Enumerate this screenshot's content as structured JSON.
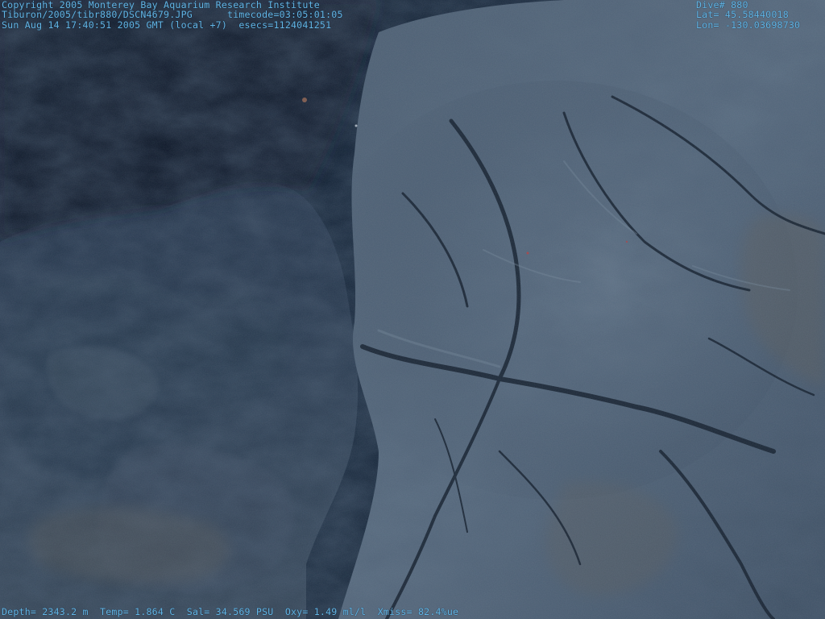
{
  "overlay": {
    "top_left": {
      "line1": "Copyright 2005 Monterey Bay Aquarium Research Institute",
      "line2": "Tiburon/2005/tibr880/DSCN4679.JPG      timecode=03:05:01:05",
      "line3": "Sun Aug 14 17:40:51 2005 GMT (local +7)  esecs=1124041251"
    },
    "top_right": {
      "dive": "Dive# 880",
      "lat": "Lat= 45.58440018",
      "lon": "Lon= -130.03698730"
    },
    "bottom": "Depth= 2343.2 m  Temp= 1.864 C  Sal= 34.569 PSU  Oxy= 1.49 ml/l  Xmiss= 82.4%ue"
  },
  "scene": {
    "subject": "underwater-rocky-seafloor-photo",
    "colors": {
      "water": "#0c1a2c",
      "rock_light": "#6d8296",
      "rock_mid": "#3f5266",
      "rock_dark": "#1d2b3b",
      "sediment": "#5e5a55",
      "text": "#62b6e6"
    }
  }
}
